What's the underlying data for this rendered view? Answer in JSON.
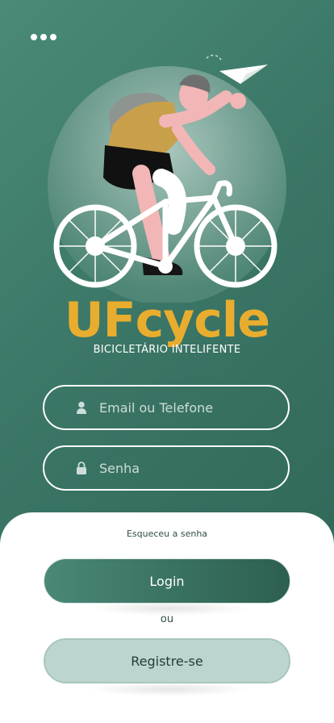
{
  "menu": {
    "icon": "more-dots-icon"
  },
  "brand": {
    "title": "UFcycle",
    "subtitle": "BICICLETÁRIO INTELIFENTE"
  },
  "form": {
    "email": {
      "placeholder": "Email ou Telefone",
      "value": "",
      "icon": "user-icon"
    },
    "password": {
      "placeholder": "Senha",
      "value": "",
      "icon": "lock-icon"
    }
  },
  "actions": {
    "forgot_label": "Esqueceu a senha",
    "login_label": "Login",
    "or_label": "ou",
    "register_label": "Registre-se"
  },
  "colors": {
    "background": "#3a7566",
    "accent": "#e8ad2e",
    "button_primary": "#3a7363",
    "button_secondary": "#bcd5cf"
  }
}
